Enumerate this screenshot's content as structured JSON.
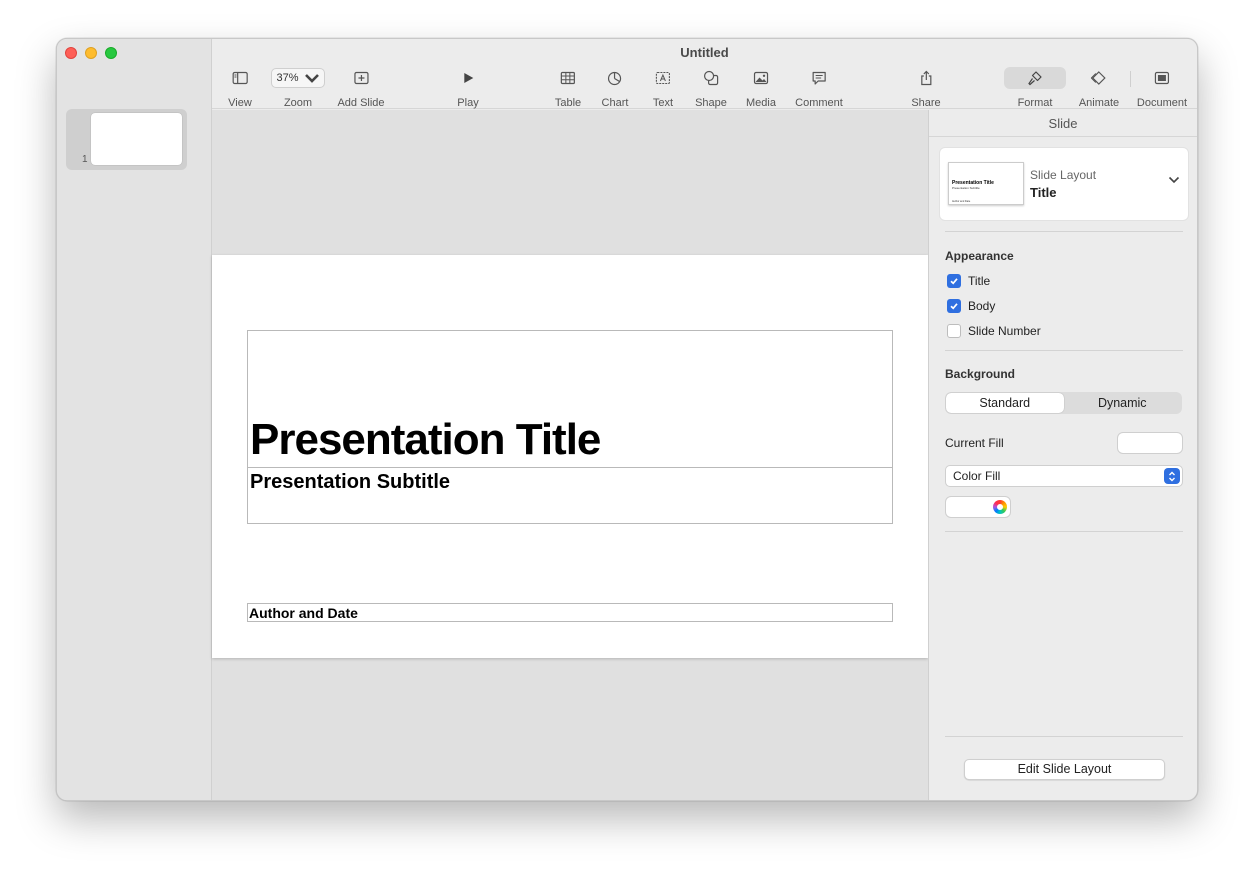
{
  "window": {
    "title": "Untitled"
  },
  "toolbar": {
    "view": "View",
    "zoom": "Zoom",
    "zoom_value": "37%",
    "add_slide": "Add Slide",
    "play": "Play",
    "table": "Table",
    "chart": "Chart",
    "text": "Text",
    "shape": "Shape",
    "media": "Media",
    "comment": "Comment",
    "share": "Share",
    "format": "Format",
    "animate": "Animate",
    "document": "Document"
  },
  "navigator": {
    "slides": [
      {
        "number": "1"
      }
    ]
  },
  "slide": {
    "title": "Presentation Title",
    "subtitle": "Presentation Subtitle",
    "author": "Author and Date"
  },
  "inspector": {
    "header": "Slide",
    "layout": {
      "label": "Slide Layout",
      "value": "Title",
      "thumb_title": "Presentation Title",
      "thumb_subtitle": "Presentation Subtitle",
      "thumb_author": "Author and Date"
    },
    "appearance": {
      "heading": "Appearance",
      "options": [
        {
          "label": "Title",
          "checked": true
        },
        {
          "label": "Body",
          "checked": true
        },
        {
          "label": "Slide Number",
          "checked": false
        }
      ]
    },
    "background": {
      "heading": "Background",
      "segments": [
        "Standard",
        "Dynamic"
      ],
      "active_segment": "Standard",
      "current_fill_label": "Current Fill",
      "fill_type": "Color Fill"
    },
    "edit_layout_button": "Edit Slide Layout"
  },
  "colors": {
    "accent": "#2f6fe0",
    "close": "#fe5f57",
    "minimize": "#febc2e",
    "maximize": "#28c840"
  }
}
